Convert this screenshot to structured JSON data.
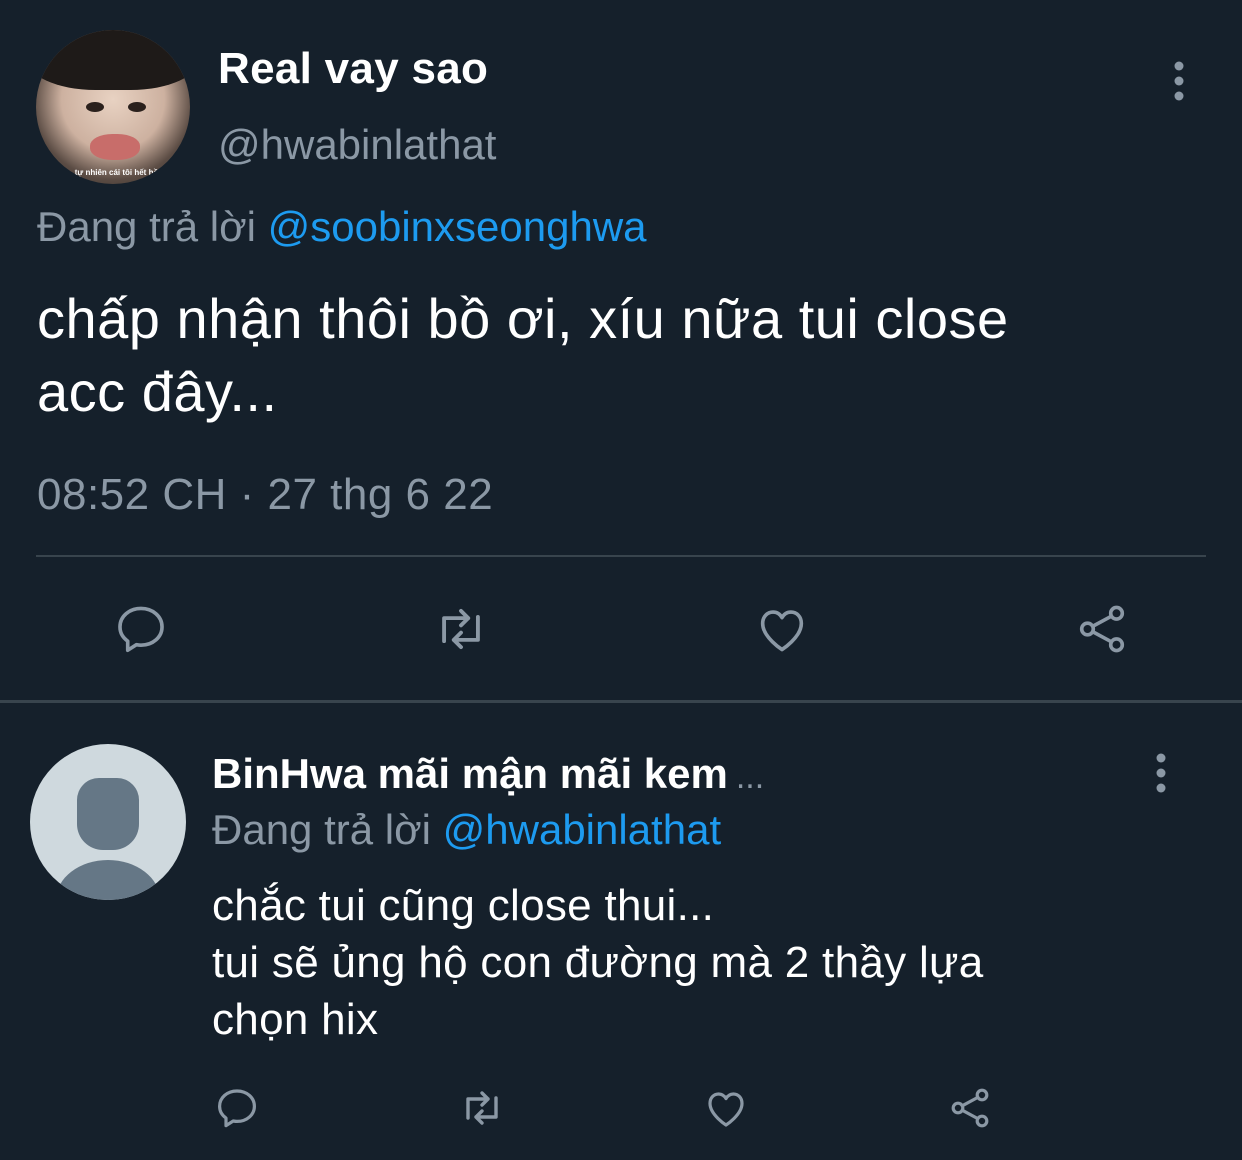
{
  "main_tweet": {
    "display_name": "Real vay sao",
    "handle": "@hwabinlathat",
    "avatar_caption": "tự nhiên cái tôi hết hồn",
    "replying_prefix": "Đang trả lời",
    "replying_to": "@soobinxseonghwa",
    "text_lines": [
      "chấp nhận thôi bồ ơi, xíu nữa tui close",
      "acc đây..."
    ],
    "timestamp": "08:52 CH · 27 thg 6 22",
    "actions": [
      "reply-icon",
      "retweet-icon",
      "like-icon",
      "share-icon"
    ]
  },
  "reply_tweet": {
    "display_name": "BinHwa mãi mận mãi kem",
    "name_overflow": "...",
    "replying_prefix": "Đang trả lời",
    "replying_to": "@hwabinlathat",
    "text_lines": [
      "chắc tui cũng close thui...",
      "tui sẽ ủng hộ con đường mà 2 thầy lựa",
      "chọn hix"
    ],
    "actions": [
      "reply-icon",
      "retweet-icon",
      "like-icon",
      "share-icon"
    ]
  },
  "colors": {
    "background": "#15202b",
    "primary_text": "#ffffff",
    "secondary_text": "#8b98a5",
    "link": "#1d9bf0",
    "divider": "#38444d"
  }
}
